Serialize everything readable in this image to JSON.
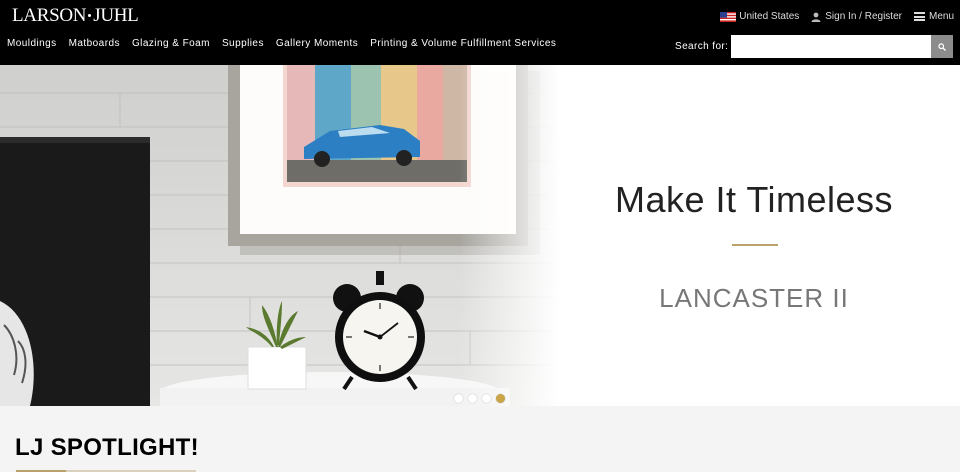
{
  "header": {
    "logo_text_left": "LARSON",
    "logo_text_right": "JUHL",
    "utility": {
      "country": "United States",
      "account": "Sign In / Register",
      "menu": "Menu"
    },
    "nav": [
      {
        "label": "Mouldings"
      },
      {
        "label": "Matboards"
      },
      {
        "label": "Glazing & Foam"
      },
      {
        "label": "Supplies"
      },
      {
        "label": "Gallery Moments"
      },
      {
        "label": "Printing & Volume Fulfillment Services"
      }
    ],
    "search": {
      "label": "Search for:",
      "value": "",
      "placeholder": ""
    }
  },
  "hero": {
    "title": "Make It Timeless",
    "subtitle": "LANCASTER II",
    "slides_total": 4,
    "active_slide": 4,
    "accent_color": "#b9a36b"
  },
  "spotlight": {
    "title": "LJ SPOTLIGHT!"
  },
  "icons": {
    "country": "us-flag-icon",
    "account": "user-icon",
    "menu": "hamburger-menu-icon",
    "search": "search-icon"
  }
}
